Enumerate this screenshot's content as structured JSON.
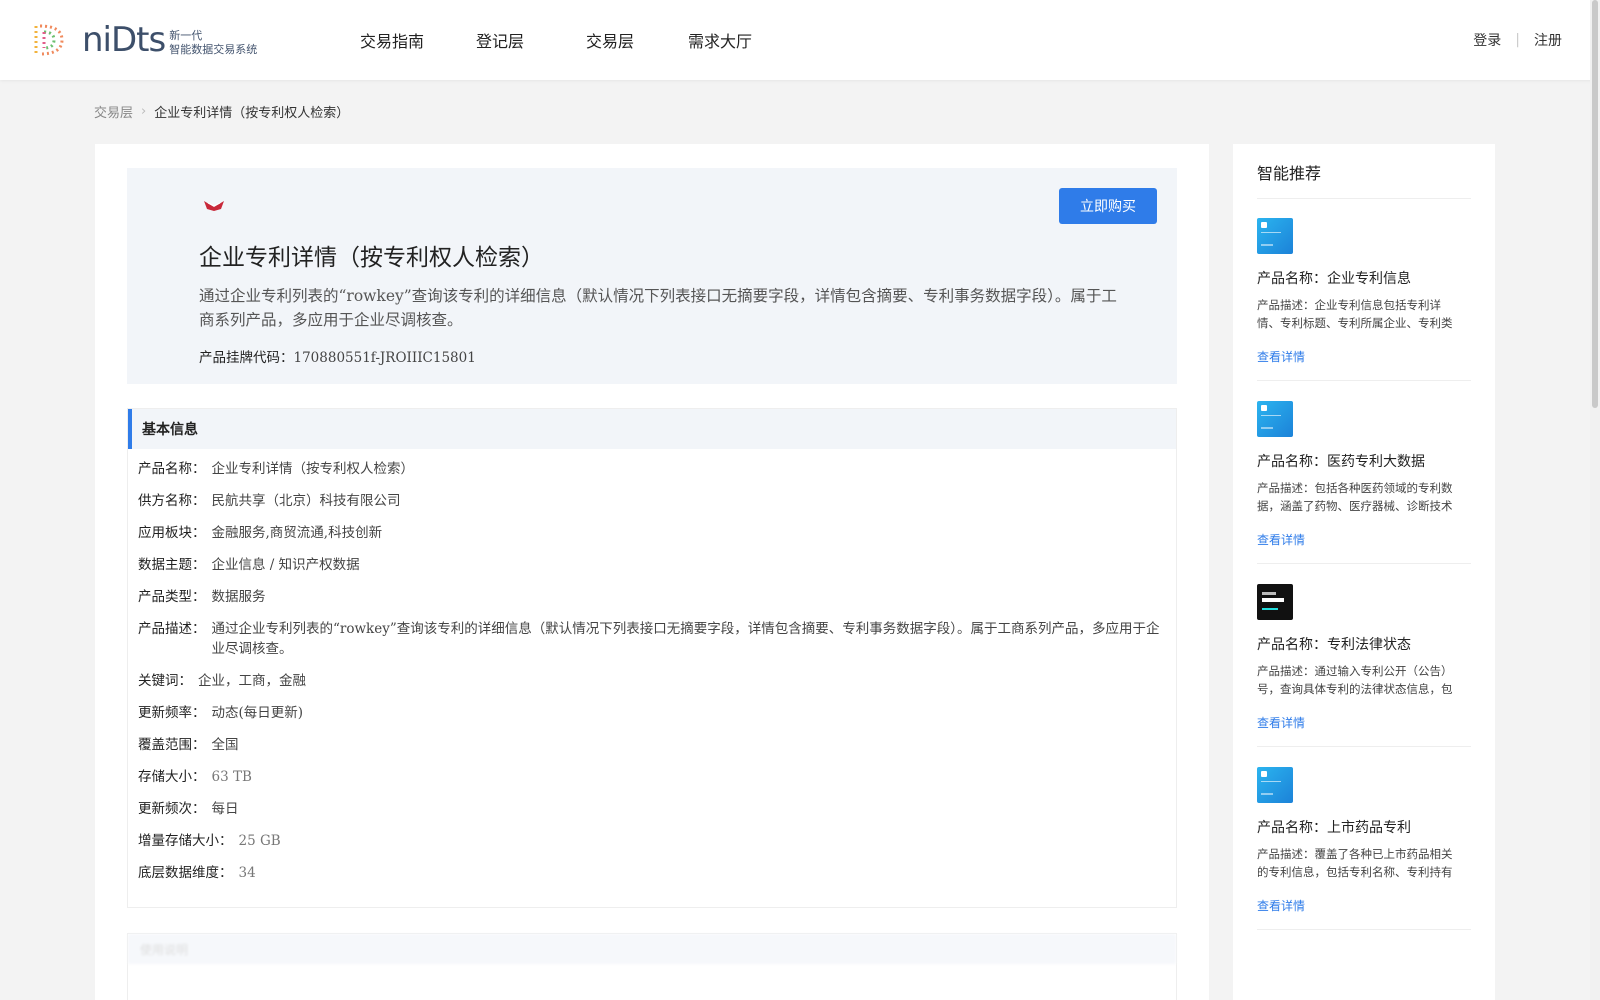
{
  "header": {
    "logo_text": "niDts",
    "logo_sub1": "新一代",
    "logo_sub2": "智能数据交易系统",
    "nav": [
      "交易指南",
      "登记层",
      "交易层",
      "需求大厅"
    ],
    "login": "登录",
    "sep": "|",
    "register": "注册"
  },
  "breadcrumb": {
    "parent": "交易层",
    "current": "企业专利详情（按专利权人检索）"
  },
  "hero": {
    "title": "企业专利详情（按专利权人检索）",
    "description": "通过企业专利列表的“rowkey”查询该专利的详细信息（默认情况下列表接口无摘要字段，详情包含摘要、专利事务数据字段）。属于工商系列产品，多应用于企业尽调核查。",
    "code_label": "产品挂牌代码：",
    "code_value": "170880551f-JROIIIC15801",
    "buy_label": "立即购买"
  },
  "info": {
    "heading": "基本信息",
    "rows": [
      {
        "k": "产品名称：",
        "v": "企业专利详情（按专利权人检索）"
      },
      {
        "k": "供方名称：",
        "v": "民航共享（北京）科技有限公司"
      },
      {
        "k": "应用板块：",
        "v": "金融服务,商贸流通,科技创新"
      },
      {
        "k": "数据主题：",
        "v": "企业信息 / 知识产权数据"
      },
      {
        "k": "产品类型：",
        "v": "数据服务"
      },
      {
        "k": "产品描述：",
        "v": "通过企业专利列表的“rowkey”查询该专利的详细信息（默认情况下列表接口无摘要字段，详情包含摘要、专利事务数据字段）。属于工商系列产品，多应用于企业尽调核查。"
      },
      {
        "k": "关键词：",
        "v": "企业，工商，金融"
      },
      {
        "k": "更新频率：",
        "v": "动态(每日更新)"
      },
      {
        "k": "覆盖范围：",
        "v": "全国"
      },
      {
        "k": "存储大小：",
        "v": "63 TB"
      },
      {
        "k": "更新频次：",
        "v": "每日"
      },
      {
        "k": "增量存储大小：",
        "v": "25 GB"
      },
      {
        "k": "底层数据维度：",
        "v": "34"
      }
    ]
  },
  "next_section": {
    "heading": "使用说明"
  },
  "sidebar": {
    "title": "智能推荐",
    "more_label": "查看详情",
    "cards": [
      {
        "name": "产品名称：企业专利信息",
        "desc": "产品描述：企业专利信息包括专利详情、专利标题、专利所属企业、专利类型等",
        "thumb": "blue"
      },
      {
        "name": "产品名称：医药专利大数据",
        "desc": "产品描述：包括各种医药领域的专利数据，涵盖了药物、医疗器械、诊断技术等",
        "thumb": "blue"
      },
      {
        "name": "产品名称：专利法律状态",
        "desc": "产品描述：通过输入专利公开（公告）号，查询具体专利的法律状态信息，包括",
        "thumb": "dark"
      },
      {
        "name": "产品名称：上市药品专利",
        "desc": "产品描述：覆盖了各种已上市药品相关的专利信息，包括专利名称、专利持有人等",
        "thumb": "blue"
      }
    ]
  }
}
